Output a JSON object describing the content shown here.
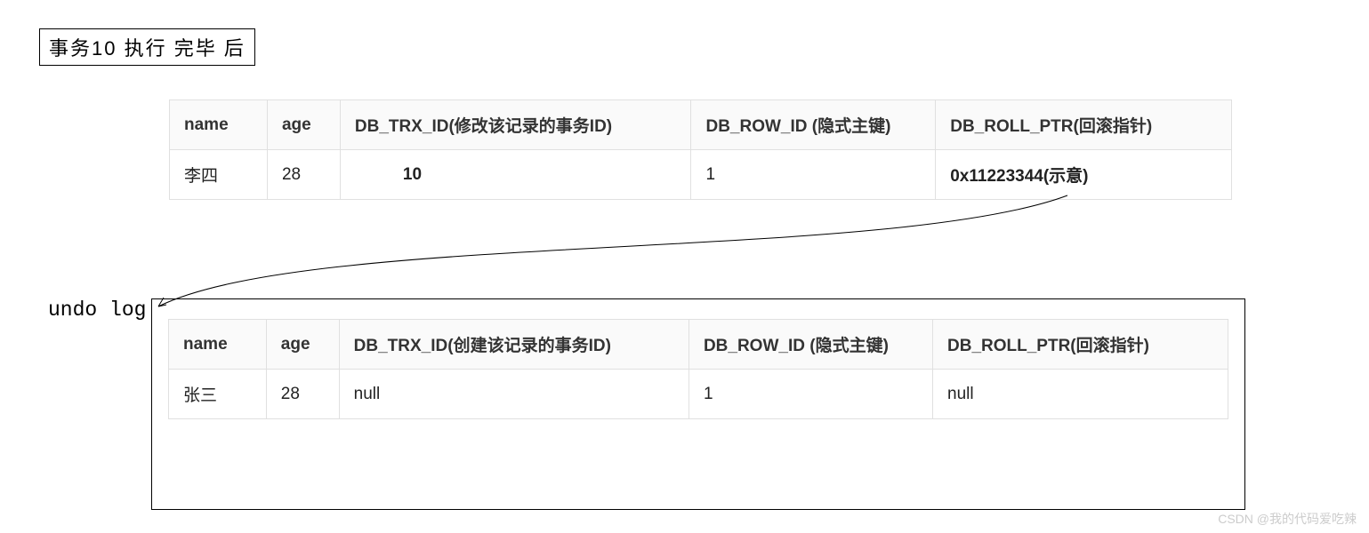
{
  "title": "事务10 执行 完毕 后",
  "table1": {
    "headers": {
      "name": "name",
      "age": "age",
      "trx": "DB_TRX_ID(修改该记录的事务ID)",
      "row": "DB_ROW_ID (隐式主键)",
      "roll": "DB_ROLL_PTR(回滚指针)"
    },
    "row": {
      "name": "李四",
      "age": "28",
      "trx": "10",
      "row": "1",
      "roll": "0x11223344(示意)"
    }
  },
  "undo_label": "undo log",
  "table2": {
    "headers": {
      "name": "name",
      "age": "age",
      "trx": "DB_TRX_ID(创建该记录的事务ID)",
      "row": "DB_ROW_ID (隐式主键)",
      "roll": "DB_ROLL_PTR(回滚指针)"
    },
    "row": {
      "name": "张三",
      "age": "28",
      "trx": "null",
      "row": "1",
      "roll": "null"
    }
  },
  "watermark": "CSDN @我的代码爱吃辣"
}
